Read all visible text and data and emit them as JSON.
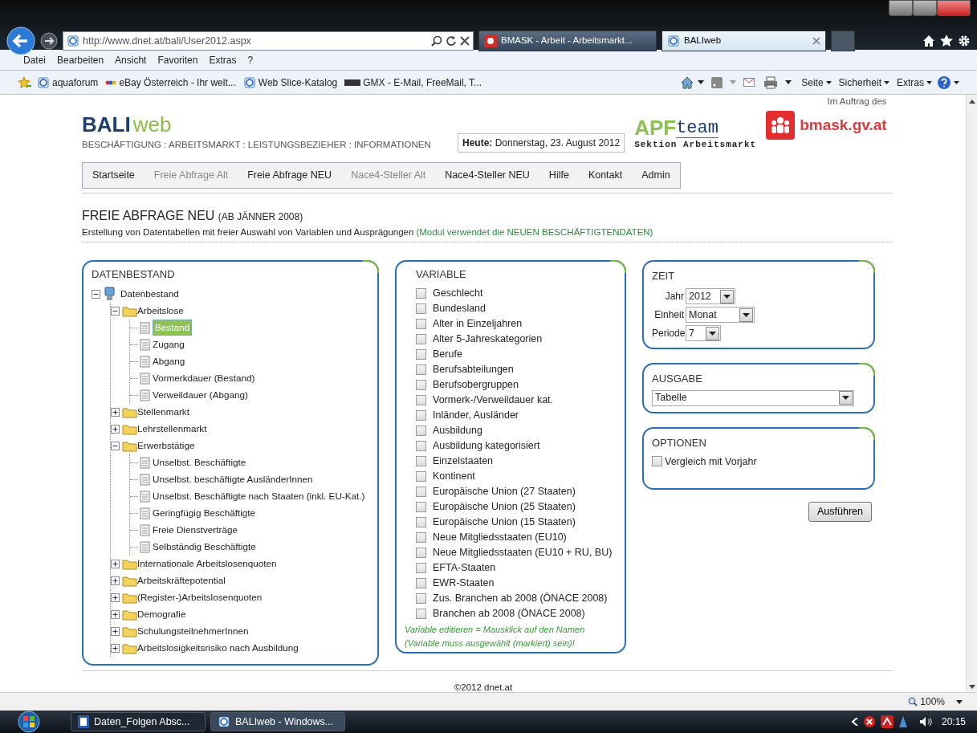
{
  "browser": {
    "address": "http://www.dnet.at/bali/User2012.aspx",
    "tabs": [
      {
        "label": "BMASK - Arbeit - Arbeitsmarkt...",
        "selected": false
      },
      {
        "label": "BALIweb",
        "selected": true
      }
    ],
    "menu": [
      "Datei",
      "Bearbeiten",
      "Ansicht",
      "Favoriten",
      "Extras",
      "?"
    ],
    "favorites": [
      "aquaforum",
      "eBay Österreich - Ihr welt...",
      "Web Slice-Katalog",
      "GMX - E-Mail, FreeMail, T..."
    ],
    "commands": [
      "Seite",
      "Sicherheit",
      "Extras"
    ]
  },
  "header": {
    "logo_bold": "BALI",
    "logo_light": "web",
    "tagline": "BESCHÄFTIGUNG : ARBEITSMARKT : LEISTUNGSBEZIEHER : INFORMATIONEN",
    "date_label": "Heute:",
    "date_value": "Donnerstag, 23. August 2012",
    "apf_a": "APF",
    "apf_b": "team",
    "apf_sub": "Sektion Arbeitsmarkt",
    "commission": "Im Auftrag des",
    "ministry": "bmask.gv.at"
  },
  "nav": [
    {
      "label": "Startseite",
      "disabled": false
    },
    {
      "label": "Freie Abfrage Alt",
      "disabled": true
    },
    {
      "label": "Freie Abfrage NEU",
      "disabled": false
    },
    {
      "label": "Nace4-Steller Alt",
      "disabled": true
    },
    {
      "label": "Nace4-Steller NEU",
      "disabled": false
    },
    {
      "label": "Hilfe",
      "disabled": false
    },
    {
      "label": "Kontakt",
      "disabled": false
    },
    {
      "label": "Admin",
      "disabled": false
    }
  ],
  "title": {
    "main": "FREIE ABFRAGE NEU",
    "sub": "(AB JÄNNER 2008)",
    "description": "Erstellung von Datentabellen mit freier Auswahl von Variablen und Ausprägungen",
    "note": "(Modul verwendet die NEUEN BESCHÄFTIGTENDATEN)"
  },
  "datenbestand": {
    "heading": "DATENBESTAND",
    "tree": [
      {
        "label": "Datenbestand",
        "expanded": true,
        "children": [
          {
            "label": "Arbeitslose",
            "expanded": true,
            "children": [
              {
                "label": "Bestand",
                "selected": true
              },
              {
                "label": "Zugang",
                "selected": false
              },
              {
                "label": "Abgang",
                "selected": false
              },
              {
                "label": "Vormerkdauer (Bestand)",
                "selected": false
              },
              {
                "label": "Verweildauer (Abgang)",
                "selected": false
              }
            ]
          },
          {
            "label": "Stellenmarkt",
            "expanded": false
          },
          {
            "label": "Lehrstellenmarkt",
            "expanded": false
          },
          {
            "label": "Erwerbstätige",
            "expanded": true,
            "children": [
              {
                "label": "Unselbst. Beschäftigte",
                "selected": false
              },
              {
                "label": "Unselbst. beschäftigte AusländerInnen",
                "selected": false
              },
              {
                "label": "Unselbst. Beschäftigte nach Staaten (inkl. EU-Kat.)",
                "selected": false
              },
              {
                "label": "Geringfügig Beschäftigte",
                "selected": false
              },
              {
                "label": "Freie Dienstverträge",
                "selected": false
              },
              {
                "label": "Selbständig Beschäftigte",
                "selected": false
              }
            ]
          },
          {
            "label": "Internationale Arbeitslosenquoten",
            "expanded": false
          },
          {
            "label": "Arbeitskräftepotential",
            "expanded": false
          },
          {
            "label": "(Register-)Arbeitslosenquoten",
            "expanded": false
          },
          {
            "label": "Demografie",
            "expanded": false
          },
          {
            "label": "SchulungsteilnehmerInnen",
            "expanded": false
          },
          {
            "label": "Arbeitslosigkeitsrisiko nach Ausbildung",
            "expanded": false
          }
        ]
      }
    ]
  },
  "variable": {
    "heading": "VARIABLE",
    "items": [
      {
        "label": "Geschlecht",
        "checked": false
      },
      {
        "label": "Bundesland",
        "checked": false
      },
      {
        "label": "Alter in Einzeljahren",
        "checked": false
      },
      {
        "label": "Alter 5-Jahreskategorien",
        "checked": false
      },
      {
        "label": "Berufe",
        "checked": false
      },
      {
        "label": "Berufsabteilungen",
        "checked": false
      },
      {
        "label": "Berufsobergruppen",
        "checked": false
      },
      {
        "label": "Vormerk-/Verweildauer kat.",
        "checked": false
      },
      {
        "label": "Inländer, Ausländer",
        "checked": false
      },
      {
        "label": "Ausbildung",
        "checked": false
      },
      {
        "label": "Ausbildung kategorisiert",
        "checked": false
      },
      {
        "label": "Einzelstaaten",
        "checked": false
      },
      {
        "label": "Kontinent",
        "checked": false
      },
      {
        "label": "Europäische Union (27 Staaten)",
        "checked": false
      },
      {
        "label": "Europäische Union (25 Staaten)",
        "checked": false
      },
      {
        "label": "Europäische Union (15 Staaten)",
        "checked": false
      },
      {
        "label": "Neue Mitgliedsstaaten (EU10)",
        "checked": false
      },
      {
        "label": "Neue Mitgliedsstaaten (EU10 + RU, BU)",
        "checked": false
      },
      {
        "label": "EFTA-Staaten",
        "checked": false
      },
      {
        "label": "EWR-Staaten",
        "checked": false
      },
      {
        "label": "Zus. Branchen ab 2008 (ÖNACE 2008)",
        "checked": false
      },
      {
        "label": "Branchen ab 2008 (ÖNACE 2008)",
        "checked": false
      }
    ],
    "hint": [
      "Variable editieren = Mausklick auf den Namen",
      "(Variable muss ausgewählt (markiert) sein)!"
    ]
  },
  "zeit": {
    "heading": "ZEIT",
    "fields": [
      {
        "label": "Jahr",
        "value": "2012"
      },
      {
        "label": "Einheit",
        "value": "Monat"
      },
      {
        "label": "Periode",
        "value": "7"
      }
    ]
  },
  "ausgabe": {
    "heading": "AUSGABE",
    "value": "Tabelle"
  },
  "optionen": {
    "heading": "OPTIONEN",
    "items": [
      {
        "label": "Vergleich mit Vorjahr",
        "checked": false
      }
    ]
  },
  "run_button": "Ausführen",
  "footer": "©2012 dnet.at",
  "status_bar": {
    "zoom": "100%"
  },
  "taskbar": {
    "items": [
      {
        "label": "Daten_Folgen Absc...",
        "selected": false
      },
      {
        "label": "BALIweb - Windows...",
        "selected": true
      }
    ],
    "clock": "20:15"
  }
}
